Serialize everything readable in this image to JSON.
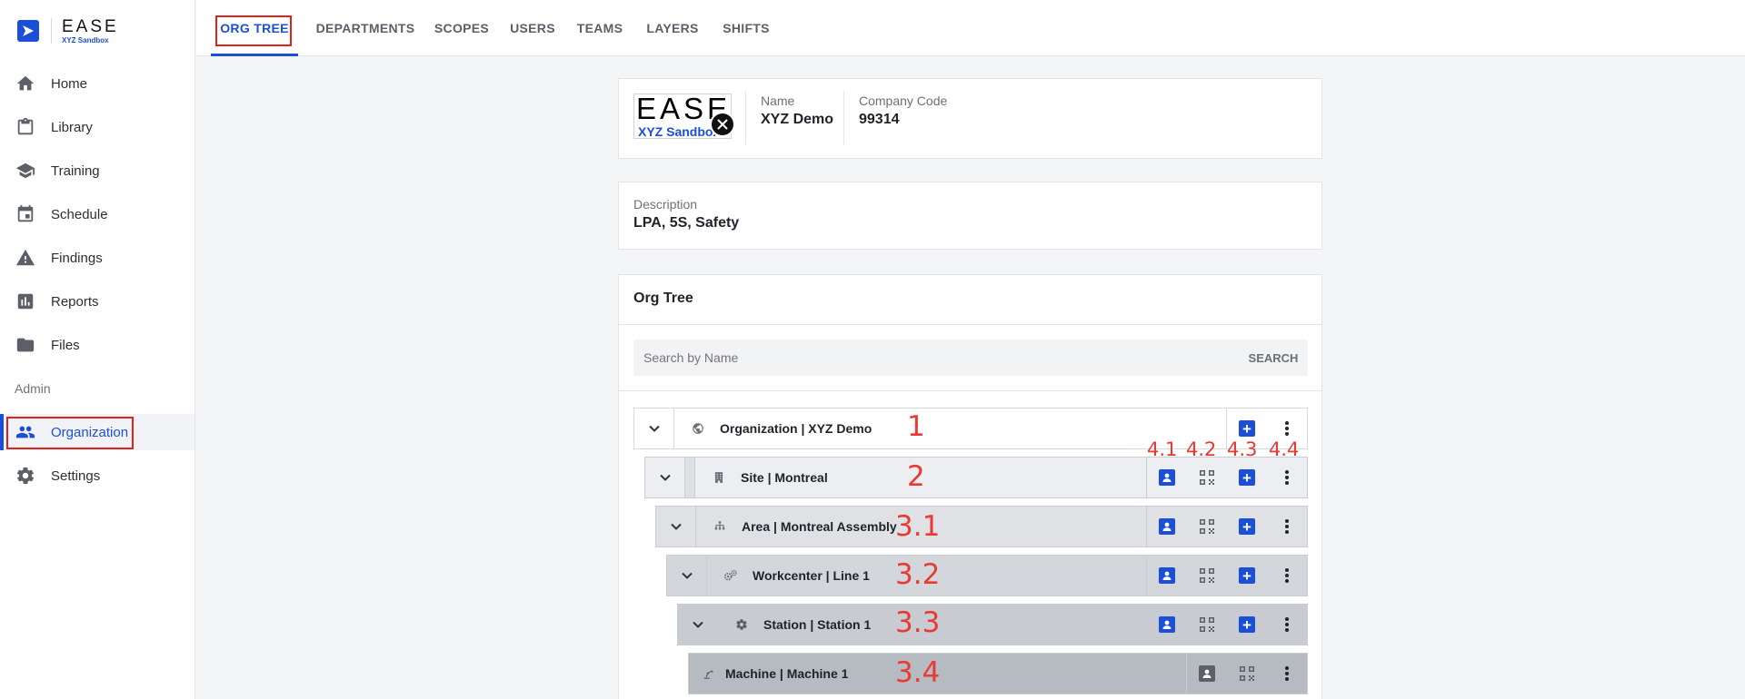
{
  "brand": {
    "name": "EASE",
    "sub": "XYZ Sandbox"
  },
  "sidebar": {
    "items": [
      {
        "label": "Home"
      },
      {
        "label": "Library"
      },
      {
        "label": "Training"
      },
      {
        "label": "Schedule"
      },
      {
        "label": "Findings"
      },
      {
        "label": "Reports"
      },
      {
        "label": "Files"
      }
    ],
    "section": "Admin",
    "admin_items": [
      {
        "label": "Organization"
      },
      {
        "label": "Settings"
      }
    ]
  },
  "tabs": [
    "ORG TREE",
    "DEPARTMENTS",
    "SCOPES",
    "USERS",
    "TEAMS",
    "LAYERS",
    "SHIFTS"
  ],
  "company": {
    "logo_name": "EASE",
    "logo_sub": "XYZ Sandbox",
    "name_label": "Name",
    "name_value": "XYZ Demo",
    "code_label": "Company Code",
    "code_value": "99314"
  },
  "description": {
    "label": "Description",
    "value": "LPA, 5S, Safety"
  },
  "org_tree": {
    "title": "Org Tree",
    "search_placeholder": "Search by Name",
    "search_button": "SEARCH",
    "rows": [
      {
        "label": "Organization | XYZ Demo",
        "icon": "globe-icon"
      },
      {
        "label": "Site | Montreal",
        "icon": "building-icon"
      },
      {
        "label": "Area | Montreal Assembly",
        "icon": "hierarchy-icon"
      },
      {
        "label": "Workcenter | Line 1",
        "icon": "gears-icon"
      },
      {
        "label": "Station | Station 1",
        "icon": "gear-icon"
      },
      {
        "label": "Machine | Machine 1",
        "icon": "robot-arm-icon"
      }
    ]
  },
  "annotations": {
    "row_numbers": [
      "1",
      "2",
      "3.1",
      "3.2",
      "3.3",
      "3.4"
    ],
    "action_numbers": [
      "4.1",
      "4.2",
      "4.3",
      "4.4"
    ]
  },
  "colors": {
    "accent": "#1b4fd8",
    "annotation": "#e83a33",
    "highlight": "#e0221b"
  }
}
